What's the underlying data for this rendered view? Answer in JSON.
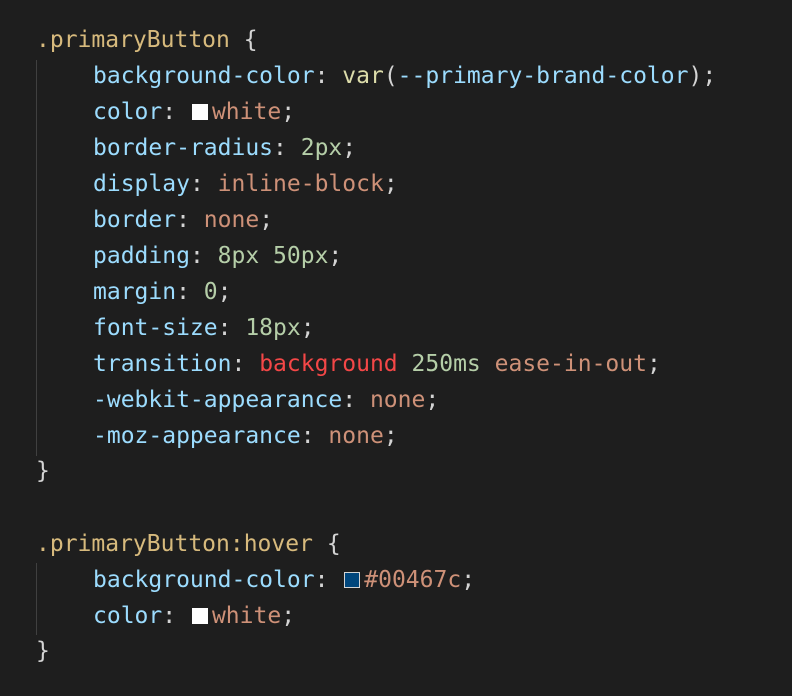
{
  "editor": {
    "rule1": {
      "selector": ".primaryButton",
      "open_brace": "{",
      "close_brace": "}",
      "declarations": [
        {
          "property": "background-color",
          "func": "var",
          "value": "--primary-brand-color"
        },
        {
          "property": "color",
          "value": "white",
          "swatch": "#ffffff"
        },
        {
          "property": "border-radius",
          "value": "2px"
        },
        {
          "property": "display",
          "value": "inline-block"
        },
        {
          "property": "border",
          "value": "none"
        },
        {
          "property": "padding",
          "value": "8px 50px"
        },
        {
          "property": "margin",
          "value": "0"
        },
        {
          "property": "font-size",
          "value": "18px"
        },
        {
          "property": "transition",
          "value_kw": "background",
          "value_num": "250ms",
          "value_str": "ease-in-out"
        },
        {
          "property": "-webkit-appearance",
          "value": "none"
        },
        {
          "property": "-moz-appearance",
          "value": "none"
        }
      ]
    },
    "rule2": {
      "selector": ".primaryButton:hover",
      "open_brace": "{",
      "close_brace": "}",
      "declarations": [
        {
          "property": "background-color",
          "value": "#00467c",
          "swatch": "#00467c"
        },
        {
          "property": "color",
          "value": "white",
          "swatch": "#ffffff"
        }
      ]
    }
  },
  "colors": {
    "background": "#1e1e1e",
    "selector": "#d7ba7d",
    "property": "#9cdcfe",
    "string_value": "#ce9178",
    "number_value": "#b5cea8",
    "keyword_value": "#f44747",
    "function": "#dcdcaa"
  }
}
